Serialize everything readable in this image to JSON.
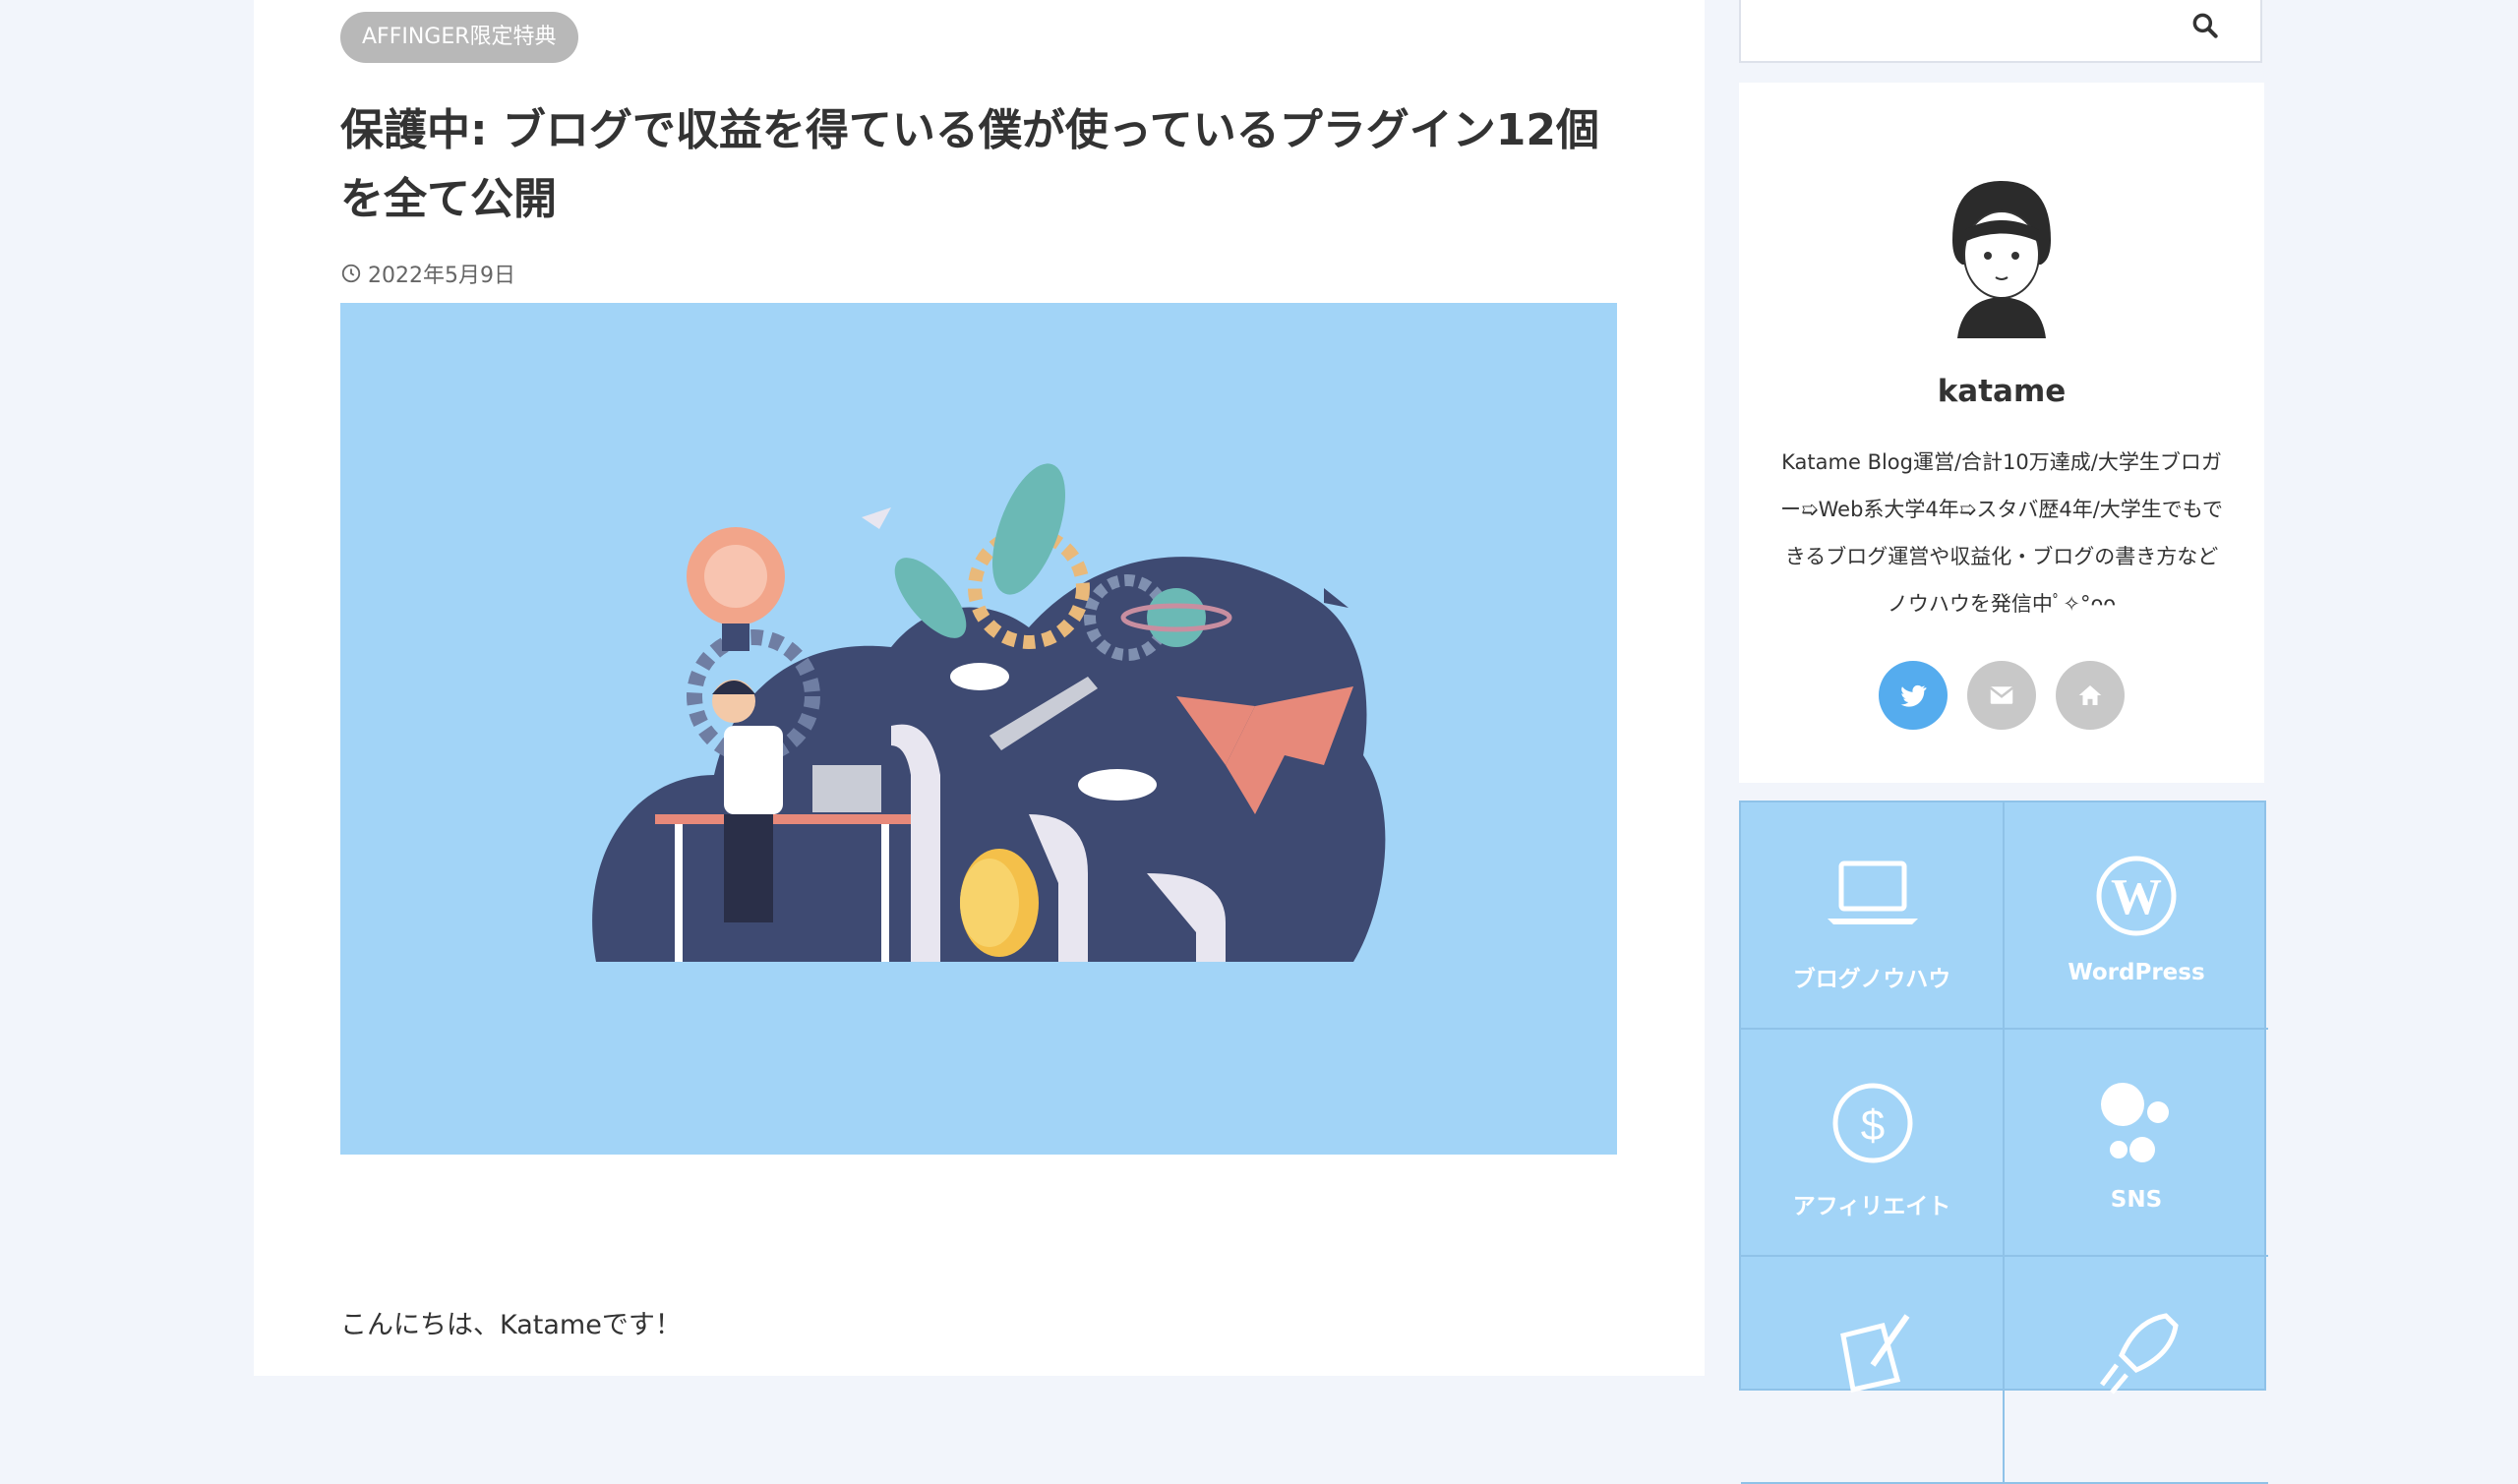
{
  "article": {
    "category": "AFFINGER限定特典",
    "title": "保護中: ブログで収益を得ている僕が使っているプラグイン12個を全て公開",
    "date": "2022年5月9日",
    "intro": "こんにちは、Katameです！"
  },
  "search": {
    "placeholder": ""
  },
  "profile": {
    "name": "katame",
    "bio": "Katame Blog運営/合計10万達成/大学生ブロガー➯Web系大学4年➯スタバ歴4年/大学生でもできるブログ運営や収益化・ブログの書き方などノウハウを発信中ﾟ✧°ᴖᴖ",
    "social": [
      {
        "icon": "twitter-icon",
        "color": "#55acee"
      },
      {
        "icon": "mail-icon",
        "color": "#c8c8c8"
      },
      {
        "icon": "home-icon",
        "color": "#c8c8c8"
      }
    ]
  },
  "categories": [
    {
      "label": "ブログノウハウ",
      "icon": "laptop-icon"
    },
    {
      "label": "WordPress",
      "icon": "wordpress-icon"
    },
    {
      "label": "アフィリエイト",
      "icon": "dollar-icon"
    },
    {
      "label": "SNS",
      "icon": "sns-icon"
    },
    {
      "label": "",
      "icon": "pen-icon"
    },
    {
      "label": "",
      "icon": "rocket-icon"
    }
  ],
  "colors": {
    "tile_bg": "#a2d4f7",
    "badge_bg": "#b8b8b8",
    "page_bg": "#f2f5fb"
  }
}
